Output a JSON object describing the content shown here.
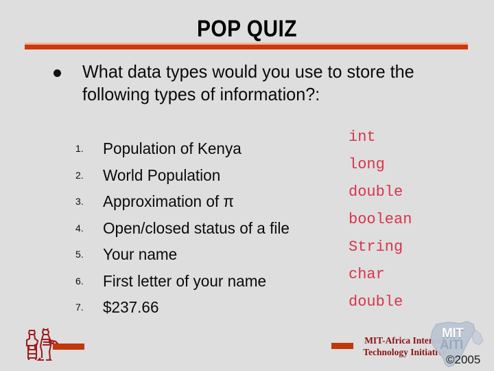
{
  "slide": {
    "background_color": "#dedede",
    "title": "POP QUIZ",
    "accent_color": "#cc3a0c",
    "accent_light_color": "#f4b49a"
  },
  "bullet": {
    "marker": "bullet-dot",
    "text": "What data types would you use to store the following types of information?:"
  },
  "quiz": {
    "items": [
      {
        "number": "1.",
        "prompt": "Population of Kenya",
        "answer": "int"
      },
      {
        "number": "2.",
        "prompt": "World Population",
        "answer": "long"
      },
      {
        "number": "3.",
        "prompt": "Approximation of π",
        "answer": "double"
      },
      {
        "number": "4.",
        "prompt": "Open/closed status of a file",
        "answer": "boolean"
      },
      {
        "number": "5.",
        "prompt": "Your name",
        "answer": "String"
      },
      {
        "number": "6.",
        "prompt": "First letter of your name",
        "answer": "char"
      },
      {
        "number": "7.",
        "prompt": "$237.66",
        "answer": "double"
      }
    ],
    "answer_color": "#d8344a"
  },
  "footer": {
    "org_line1": "MIT-Africa Internet",
    "org_line2": "Technology Initiative",
    "org_color": "#8d1212",
    "logo_mit": "MIT",
    "logo_aiti": "AITI",
    "copyright": "©2005",
    "figure_icon": "two-figures-icon"
  }
}
